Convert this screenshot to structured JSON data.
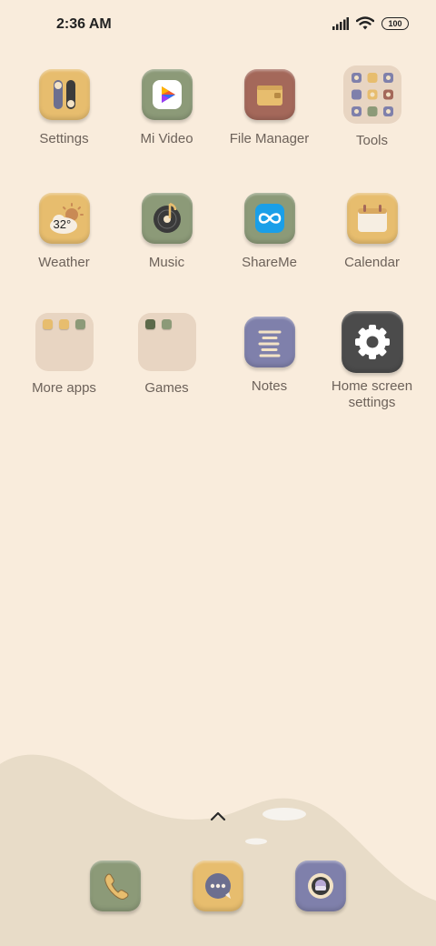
{
  "status_bar": {
    "time": "2:36 AM",
    "battery": "100",
    "icons": [
      "signal-icon",
      "wifi-icon",
      "battery-icon"
    ]
  },
  "apps": [
    {
      "label": "Settings",
      "icon": "toggle-switches-icon",
      "color": "#e7bd6e"
    },
    {
      "label": "Mi Video",
      "icon": "play-icon",
      "color": "#8c9a78"
    },
    {
      "label": "File Manager",
      "icon": "wallet-folder-icon",
      "color": "#a4685a"
    },
    {
      "label": "Tools",
      "icon": "folder",
      "color": "#e8d5c2"
    },
    {
      "label": "Weather",
      "icon": "sun-cloud-icon",
      "color": "#e7bd6e",
      "badge": "32°"
    },
    {
      "label": "Music",
      "icon": "music-disc-icon",
      "color": "#8c9a78"
    },
    {
      "label": "ShareMe",
      "icon": "infinity-icon",
      "color": "#8c9a78"
    },
    {
      "label": "Calendar",
      "icon": "calendar-icon",
      "color": "#e7bd6e"
    },
    {
      "label": "More apps",
      "icon": "folder",
      "color": "#e8d5c2"
    },
    {
      "label": "Games",
      "icon": "folder",
      "color": "#e8d5c2"
    },
    {
      "label": "Notes",
      "icon": "notes-lines-icon",
      "color": "#7f80ab"
    },
    {
      "label": "Home screen settings",
      "icon": "gear-icon",
      "color": "#4b4b4b"
    }
  ],
  "dock": [
    {
      "name": "phone",
      "icon": "phone-icon",
      "color": "#8c9a78"
    },
    {
      "name": "messages",
      "icon": "chat-bubble-icon",
      "color": "#e7bd6e"
    },
    {
      "name": "camera",
      "icon": "camera-lens-icon",
      "color": "#7f80ab"
    }
  ]
}
